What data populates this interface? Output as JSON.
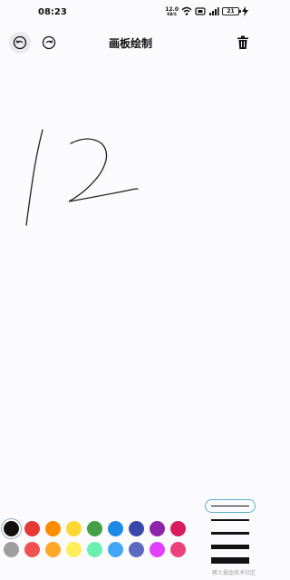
{
  "status_bar": {
    "time": "08:23",
    "net_speed_value": "12.0",
    "net_speed_unit": "KB/S",
    "battery": "21"
  },
  "header": {
    "title": "画板绘制",
    "undo_icon": "undo-icon",
    "redo_icon": "redo-icon",
    "delete_icon": "trash-icon"
  },
  "palette": {
    "row1": [
      "#111111",
      "#e53935",
      "#fb8c00",
      "#fdd835",
      "#43a047",
      "#1e88e5",
      "#3949ab",
      "#8e24aa",
      "#d81b60"
    ],
    "row2": [
      "#9e9e9e",
      "#ef5350",
      "#ffa726",
      "#ffee58",
      "#69f0ae",
      "#42a5f5",
      "#5c6bc0",
      "#e040fb",
      "#ec407a"
    ],
    "selected_color": "#111111"
  },
  "stroke_widths": {
    "options": [
      1,
      2,
      3,
      5,
      7
    ],
    "selected_index": 0
  },
  "watermark": "稀土掘金技术社区"
}
